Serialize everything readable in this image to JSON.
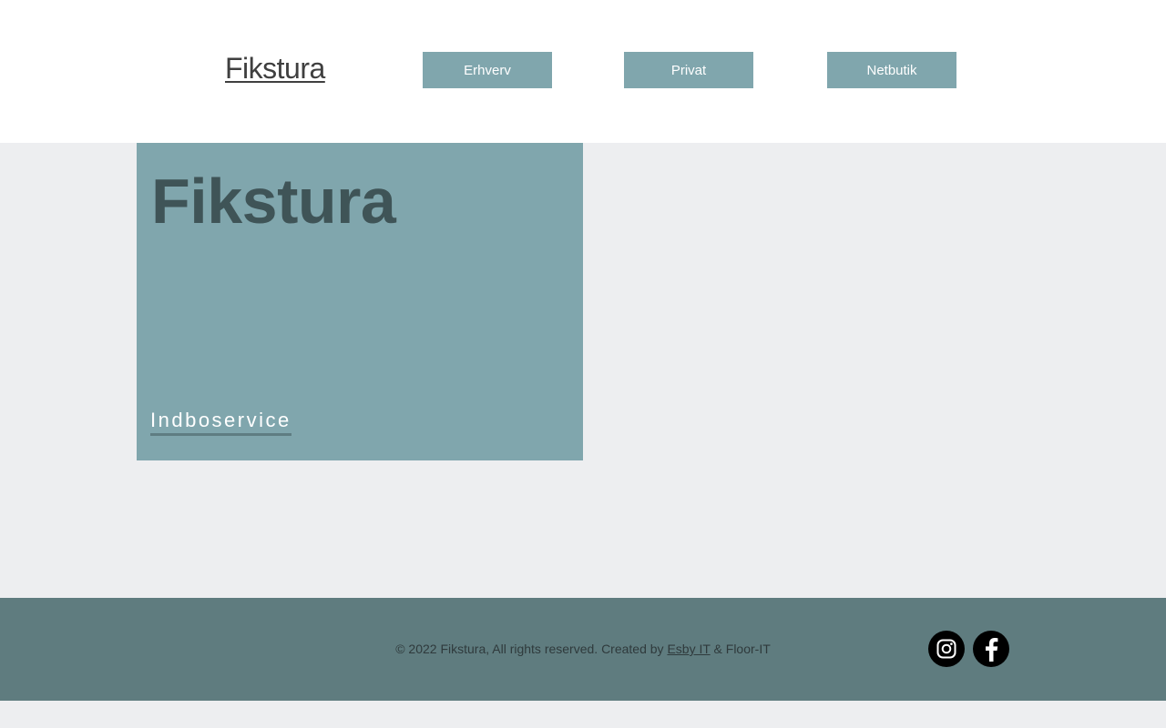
{
  "header": {
    "logo": "Fikstura",
    "nav": [
      {
        "label": "Erhverv"
      },
      {
        "label": "Privat"
      },
      {
        "label": "Netbutik"
      }
    ]
  },
  "hero": {
    "title": "Fikstura",
    "link": "Indboservice"
  },
  "footer": {
    "copyright_prefix": "© 2022 Fikstura, All rights reserved. Created by ",
    "esby_link": "Esby IT",
    "copyright_suffix": " & Floor-IT",
    "social": [
      {
        "icon": "instagram-icon"
      },
      {
        "icon": "facebook-icon"
      }
    ]
  },
  "colors": {
    "accent": "#80a6ad",
    "footer_bg": "#5f7c7f",
    "page_bg": "#edeef0",
    "hero_title": "#3f5457"
  }
}
